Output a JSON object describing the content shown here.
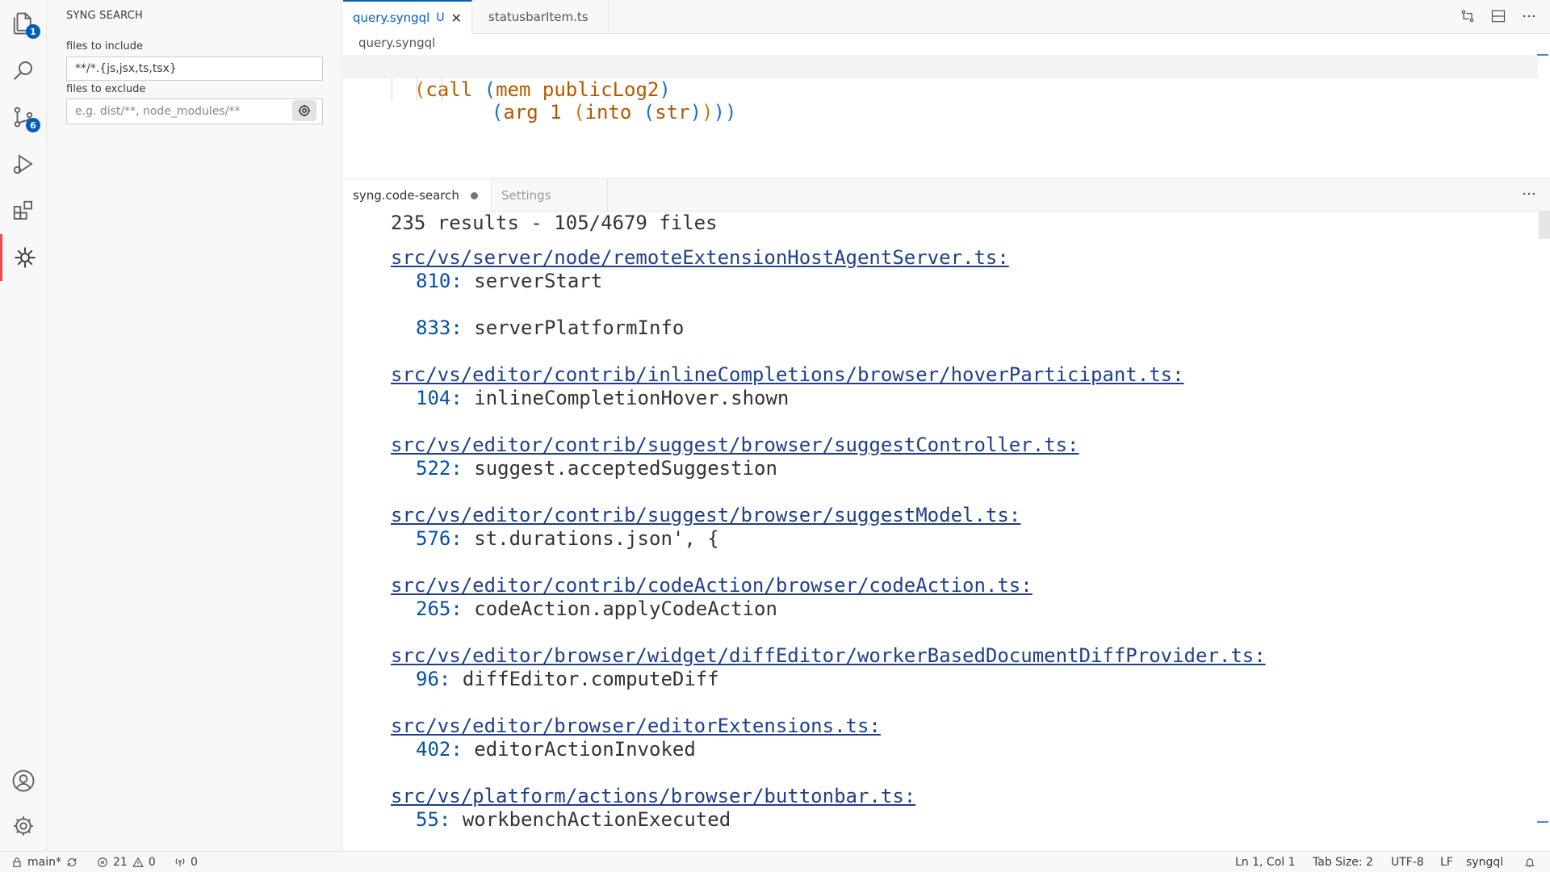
{
  "activity": {
    "explorer_badge": "1",
    "scm_badge": "6"
  },
  "sidebar": {
    "title": "SYNG SEARCH",
    "include_label": "files to include",
    "include_value": "**/*.{js,jsx,ts,tsx}",
    "exclude_label": "files to exclude",
    "exclude_placeholder": "e.g. dist/**, node_modules/**"
  },
  "tabs": [
    {
      "label": "query.syngql",
      "modified": "U"
    },
    {
      "label": "statusbarItem.ts"
    }
  ],
  "breadcrumb": "query.syngql",
  "query": {
    "line1": [
      "(",
      "call",
      " ",
      "(",
      "mem",
      " ",
      "publicLog2",
      ")"
    ],
    "line2": [
      "(",
      "arg",
      " ",
      "1",
      " ",
      "(",
      "into",
      " ",
      "(",
      "str",
      ")",
      ")",
      ")",
      ")"
    ]
  },
  "tabs2": [
    {
      "label": "syng.code-search"
    },
    {
      "label": "Settings"
    }
  ],
  "results": {
    "summary": "235 results - 105/4679 files",
    "groups": [
      {
        "file": "src/vs/server/node/remoteExtensionHostAgentServer.ts:",
        "matches": [
          {
            "ln": "810:",
            "text": "serverStart"
          },
          {
            "ln": "833:",
            "text": "serverPlatformInfo"
          }
        ]
      },
      {
        "file": "src/vs/editor/contrib/inlineCompletions/browser/hoverParticipant.ts:",
        "matches": [
          {
            "ln": "104:",
            "text": "inlineCompletionHover.shown"
          }
        ]
      },
      {
        "file": "src/vs/editor/contrib/suggest/browser/suggestController.ts:",
        "matches": [
          {
            "ln": "522:",
            "text": "suggest.acceptedSuggestion"
          }
        ]
      },
      {
        "file": "src/vs/editor/contrib/suggest/browser/suggestModel.ts:",
        "matches": [
          {
            "ln": "576:",
            "text": "st.durations.json', {"
          }
        ]
      },
      {
        "file": "src/vs/editor/contrib/codeAction/browser/codeAction.ts:",
        "matches": [
          {
            "ln": "265:",
            "text": "codeAction.applyCodeAction"
          }
        ]
      },
      {
        "file": "src/vs/editor/browser/widget/diffEditor/workerBasedDocumentDiffProvider.ts:",
        "matches": [
          {
            "ln": "96:",
            "text": "diffEditor.computeDiff"
          }
        ]
      },
      {
        "file": "src/vs/editor/browser/editorExtensions.ts:",
        "matches": [
          {
            "ln": "402:",
            "text": "editorActionInvoked"
          }
        ]
      },
      {
        "file": "src/vs/platform/actions/browser/buttonbar.ts:",
        "matches": [
          {
            "ln": "55:",
            "text": "workbenchActionExecuted"
          }
        ]
      }
    ]
  },
  "status": {
    "branch": "main*",
    "errors": "21",
    "warnings": "0",
    "ports": "0",
    "position": "Ln 1, Col 1",
    "tab_size": "Tab Size: 2",
    "encoding": "UTF-8",
    "eol": "LF",
    "language": "syngql"
  },
  "colors": {
    "accent": "#005fb8",
    "paren_orange": "#c8790e",
    "paren_blue": "#1a73c9",
    "keyword": "#b35900",
    "link": "#1f3f8a",
    "line_number": "#0451a5"
  }
}
